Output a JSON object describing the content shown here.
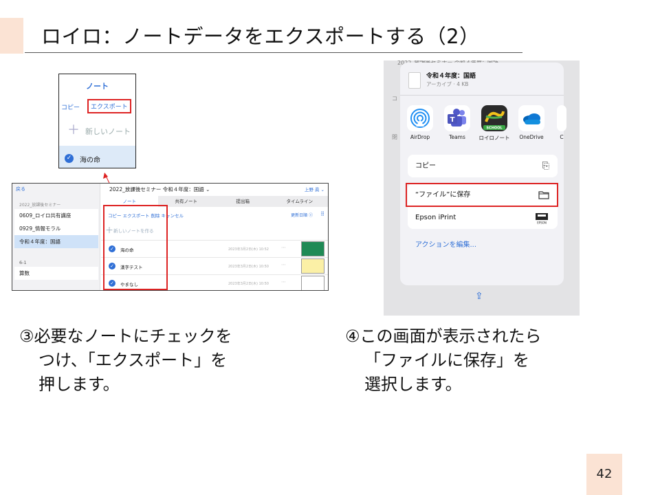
{
  "slide": {
    "title": "ロイロ：ノートデータをエクスポートする（2）",
    "page_number": "42"
  },
  "zoom": {
    "title": "ノート",
    "copy": "コピー",
    "export": "エクスポート",
    "new_note": "新しいノート",
    "note": "海の命"
  },
  "app": {
    "back": "戻る",
    "group": "2022_放課後セミナー",
    "sidebar_items": [
      "0609_ロイロ共有講座",
      "0929_情報モラル",
      "令和４年度：国語"
    ],
    "sidebar_group2": "6-1",
    "sidebar_item4": "算数",
    "header": "2022_放課後セミナー 令和４年度：国語 ⌄",
    "user": "上野 眞 ⌄",
    "tabs": [
      "ノート",
      "共有ノート",
      "提出箱",
      "タイムライン"
    ],
    "tools": "コピー  エクスポート  削除  キャンセル",
    "sort": "更新日順 ⓥ",
    "new_note": "新しいノートを作る",
    "rows": [
      {
        "name": "海の命",
        "date": "2023年3月2日(木) 10:52",
        "color": "#1f8a55"
      },
      {
        "name": "漢字テスト",
        "date": "2023年3月2日(木) 10:50",
        "color": "#fbf0a6"
      },
      {
        "name": "やまなし",
        "date": "2023年3月2日(木) 10:50",
        "color": "#ffffff"
      }
    ]
  },
  "share": {
    "bg_header": "2022_放課後セミナー 令和４年度：国語 ⌄",
    "bg_side1": "コ",
    "bg_side2": "閉",
    "file_name": "令和４年度：国語",
    "file_meta": "アーカイブ · 4 KB",
    "apps": [
      {
        "label": "AirDrop",
        "icon": "airdrop-icon",
        "color": "#ffffff"
      },
      {
        "label": "Teams",
        "icon": "teams-icon",
        "color": "#ffffff"
      },
      {
        "label": "ロイロノート",
        "icon": "loilo-note-icon",
        "color": "#2b2b2b"
      },
      {
        "label": "OneDrive",
        "icon": "onedrive-icon",
        "color": "#ffffff"
      },
      {
        "label": "C",
        "icon": "partial-app-icon",
        "color": "#ffffff"
      }
    ],
    "school_badge": "SCHOOL",
    "copy": "コピー",
    "save_to_files": "“ファイル”に保存",
    "epson": "Epson iPrint",
    "epson_badge": "EPSON",
    "edit_actions": "アクションを編集..."
  },
  "captions": {
    "left": [
      "③必要なノートにチェックを",
      "つけ、「エクスポート」を",
      "押します。"
    ],
    "right": [
      "④この画面が表示されたら",
      "「ファイルに保存」を",
      "選択します。"
    ]
  }
}
